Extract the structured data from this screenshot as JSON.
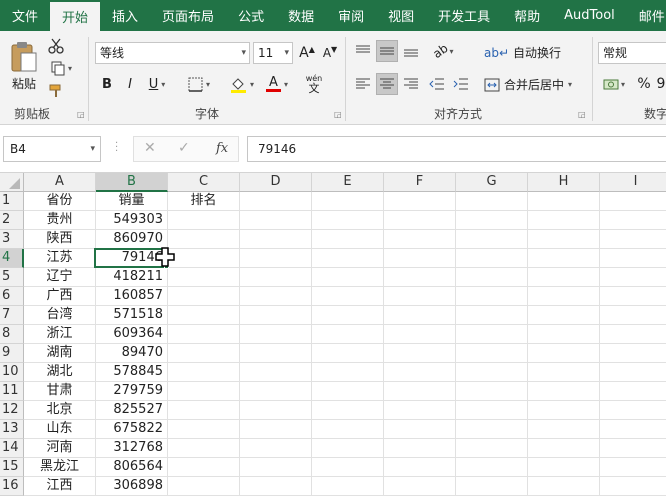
{
  "ribbon_tabs": [
    "文件",
    "开始",
    "插入",
    "页面布局",
    "公式",
    "数据",
    "审阅",
    "视图",
    "开发工具",
    "帮助",
    "AudTool",
    "邮件"
  ],
  "ribbon": {
    "clipboard": {
      "paste_label": "粘贴",
      "group_label": "剪贴板"
    },
    "font": {
      "font_name": "等线",
      "font_size": "11",
      "bold": "B",
      "italic": "I",
      "underline": "U",
      "grow_font": "A",
      "shrink_font": "A",
      "group_label": "字体",
      "phonetic": "wén"
    },
    "alignment": {
      "wrap_text_label": "自动换行",
      "merge_center_label": "合并后居中",
      "group_label": "对齐方式"
    },
    "number": {
      "format": "常规",
      "percent": "%",
      "comma": "9",
      "group_label": "数字"
    }
  },
  "formula_bar": {
    "name_box": "B4",
    "fx_label": "fx",
    "cancel_symbol": "✕",
    "enter_symbol": "✓",
    "formula": "79146"
  },
  "sheet": {
    "columns": [
      "A",
      "B",
      "C",
      "D",
      "E",
      "F",
      "G",
      "H",
      "I"
    ],
    "rows": [
      {
        "num": "1",
        "A": "省份",
        "B": "销量",
        "C": "排名"
      },
      {
        "num": "2",
        "A": "贵州",
        "B": "549303",
        "C": ""
      },
      {
        "num": "3",
        "A": "陕西",
        "B": "860970",
        "C": ""
      },
      {
        "num": "4",
        "A": "江苏",
        "B": "79146",
        "C": ""
      },
      {
        "num": "5",
        "A": "辽宁",
        "B": "418211",
        "C": ""
      },
      {
        "num": "6",
        "A": "广西",
        "B": "160857",
        "C": ""
      },
      {
        "num": "7",
        "A": "台湾",
        "B": "571518",
        "C": ""
      },
      {
        "num": "8",
        "A": "浙江",
        "B": "609364",
        "C": ""
      },
      {
        "num": "9",
        "A": "湖南",
        "B": "89470",
        "C": ""
      },
      {
        "num": "10",
        "A": "湖北",
        "B": "578845",
        "C": ""
      },
      {
        "num": "11",
        "A": "甘肃",
        "B": "279759",
        "C": ""
      },
      {
        "num": "12",
        "A": "北京",
        "B": "825527",
        "C": ""
      },
      {
        "num": "13",
        "A": "山东",
        "B": "675822",
        "C": ""
      },
      {
        "num": "14",
        "A": "河南",
        "B": "312768",
        "C": ""
      },
      {
        "num": "15",
        "A": "黑龙江",
        "B": "806564",
        "C": ""
      },
      {
        "num": "16",
        "A": "江西",
        "B": "306898",
        "C": ""
      }
    ],
    "active_cell": "B4",
    "accent_color": "#217346"
  }
}
